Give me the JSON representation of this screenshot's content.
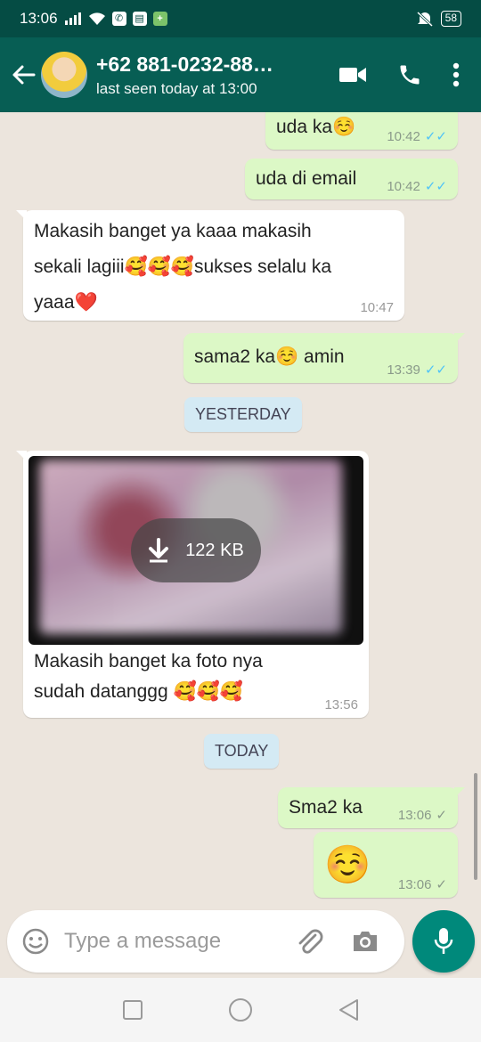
{
  "status_bar": {
    "time": "13:06",
    "battery": "58"
  },
  "header": {
    "title": "+62 881-0232-88…",
    "subtitle": "last seen today at 13:00"
  },
  "messages": [
    {
      "text": "uda ka",
      "time": "10:42",
      "direction": "out",
      "status": "read"
    },
    {
      "text": "uda di email",
      "time": "10:42",
      "direction": "out",
      "status": "read"
    },
    {
      "text_lines": [
        "Makasih banget ya kaaa makasih",
        "sekali lagiii🥰🥰🥰sukses selalu ka",
        "yaaa❤️"
      ],
      "time": "10:47",
      "direction": "in"
    },
    {
      "text": "sama2 ka",
      "text_after": " amin",
      "time": "13:39",
      "direction": "out",
      "status": "read"
    },
    {
      "text_lines": [
        "Makasih banget ka foto nya",
        "sudah datanggg 🥰🥰🥰"
      ],
      "time": "13:56",
      "direction": "in",
      "media_size": "122 KB"
    },
    {
      "text": "Sma2 ka",
      "time": "13:06",
      "direction": "out",
      "status": "delivered"
    },
    {
      "text": "☺️",
      "time": "13:06",
      "direction": "out",
      "status": "delivered"
    }
  ],
  "date_chips": {
    "yesterday": "YESTERDAY",
    "today": "TODAY"
  },
  "emoji": {
    "smile": "☺️"
  },
  "input": {
    "placeholder": "Type a message"
  },
  "colors": {
    "header": "#075e54",
    "status_bar": "#054c44",
    "outgoing_bubble": "#dcf8c6",
    "incoming_bubble": "#ffffff",
    "read_tick": "#4fc3f7",
    "fab": "#00897b"
  },
  "icons": {
    "back": "arrow-left-icon",
    "video": "video-call-icon",
    "call": "phone-icon",
    "menu": "more-vert-icon",
    "emoji": "emoji-icon",
    "attach": "paperclip-icon",
    "camera": "camera-icon",
    "mic": "mic-icon",
    "download": "download-icon"
  }
}
